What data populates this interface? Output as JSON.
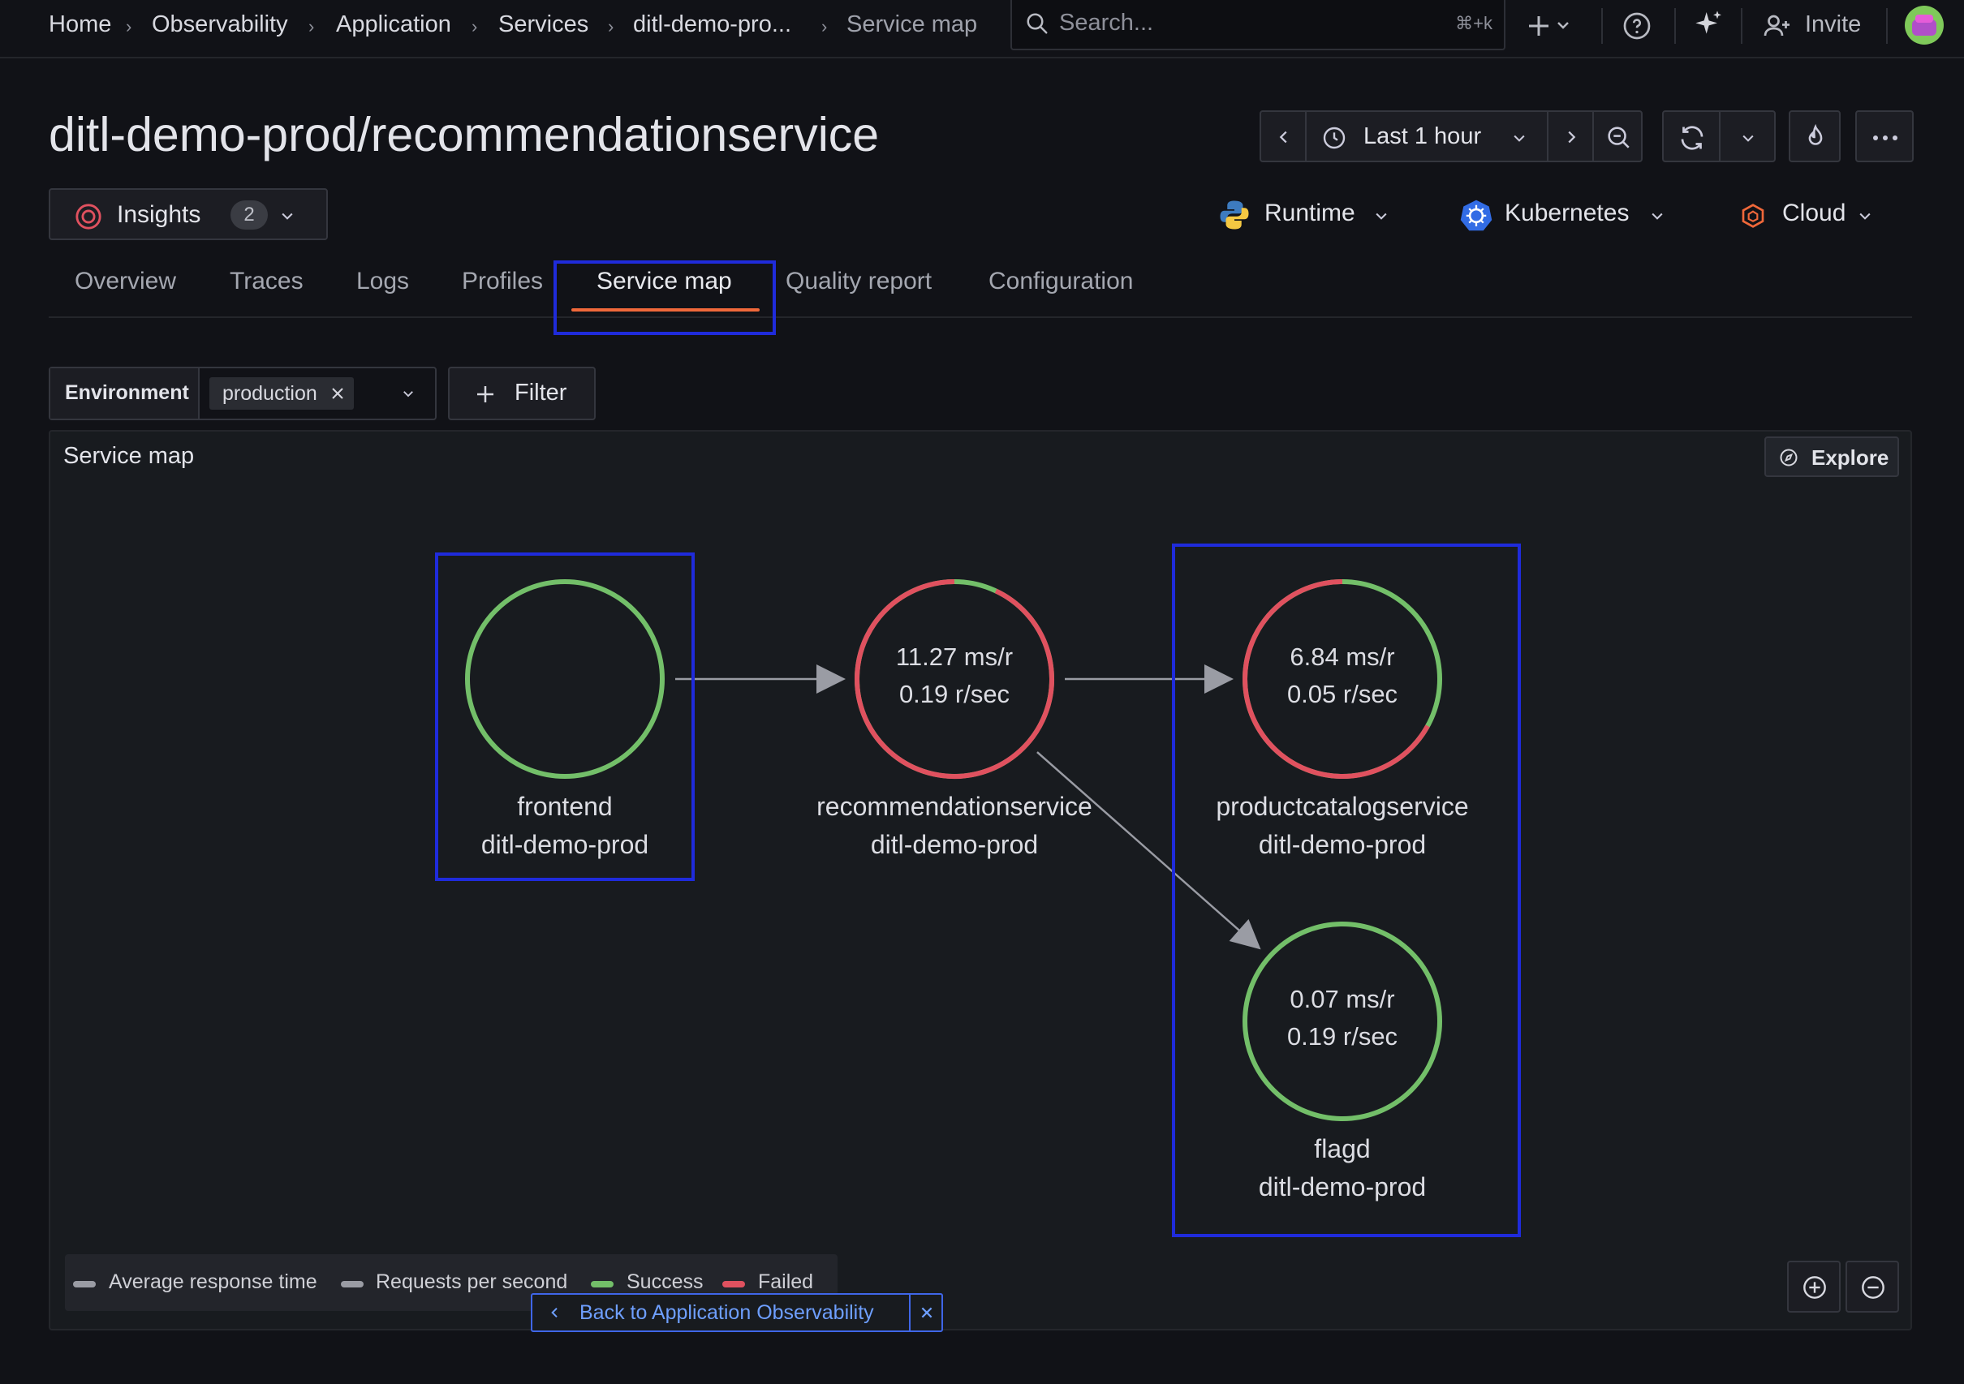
{
  "breadcrumb": [
    "Home",
    "Observability",
    "Application",
    "Services",
    "ditl-demo-pro...",
    "Service map"
  ],
  "search": {
    "placeholder": "Search...",
    "shortcut": "⌘+k"
  },
  "topbar": {
    "invite_label": "Invite"
  },
  "page": {
    "title": "ditl-demo-prod/recommendationservice"
  },
  "time_picker": {
    "label": "Last 1 hour"
  },
  "insights": {
    "label": "Insights",
    "count": "2"
  },
  "integrations": [
    {
      "label": "Runtime",
      "icon": "python-icon"
    },
    {
      "label": "Kubernetes",
      "icon": "kubernetes-icon"
    },
    {
      "label": "Cloud",
      "icon": "cloud-cube-icon"
    }
  ],
  "tabs": [
    "Overview",
    "Traces",
    "Logs",
    "Profiles",
    "Service map",
    "Quality report",
    "Configuration"
  ],
  "active_tab": "Service map",
  "filters": {
    "environment_label": "Environment",
    "environment_value": "production",
    "filter_button": "Filter"
  },
  "panel": {
    "title": "Service map",
    "explore_label": "Explore"
  },
  "service_map": {
    "nodes": [
      {
        "id": "frontend",
        "name": "frontend",
        "namespace": "ditl-demo-prod",
        "latency": "",
        "rate": "",
        "failed_fraction": 0.0
      },
      {
        "id": "recommendationservice",
        "name": "recommendationservice",
        "namespace": "ditl-demo-prod",
        "latency": "11.27 ms/r",
        "rate": "0.19 r/sec",
        "failed_fraction": 0.93
      },
      {
        "id": "productcatalogservice",
        "name": "productcatalogservice",
        "namespace": "ditl-demo-prod",
        "latency": "6.84 ms/r",
        "rate": "0.05 r/sec",
        "failed_fraction": 0.67
      },
      {
        "id": "flagd",
        "name": "flagd",
        "namespace": "ditl-demo-prod",
        "latency": "0.07 ms/r",
        "rate": "0.19 r/sec",
        "failed_fraction": 0.0
      }
    ],
    "edges": [
      {
        "from": "frontend",
        "to": "recommendationservice"
      },
      {
        "from": "recommendationservice",
        "to": "productcatalogservice"
      },
      {
        "from": "recommendationservice",
        "to": "flagd"
      }
    ]
  },
  "legend": [
    "Average response time",
    "Requests per second",
    "Success",
    "Failed"
  ],
  "colors": {
    "success": "#73bf69",
    "failed": "#e0515f",
    "highlight": "#1f2bdb",
    "tab_underline": "#f0683a",
    "link": "#6e9fff"
  },
  "back_banner": {
    "label": "Back to Application Observability"
  }
}
